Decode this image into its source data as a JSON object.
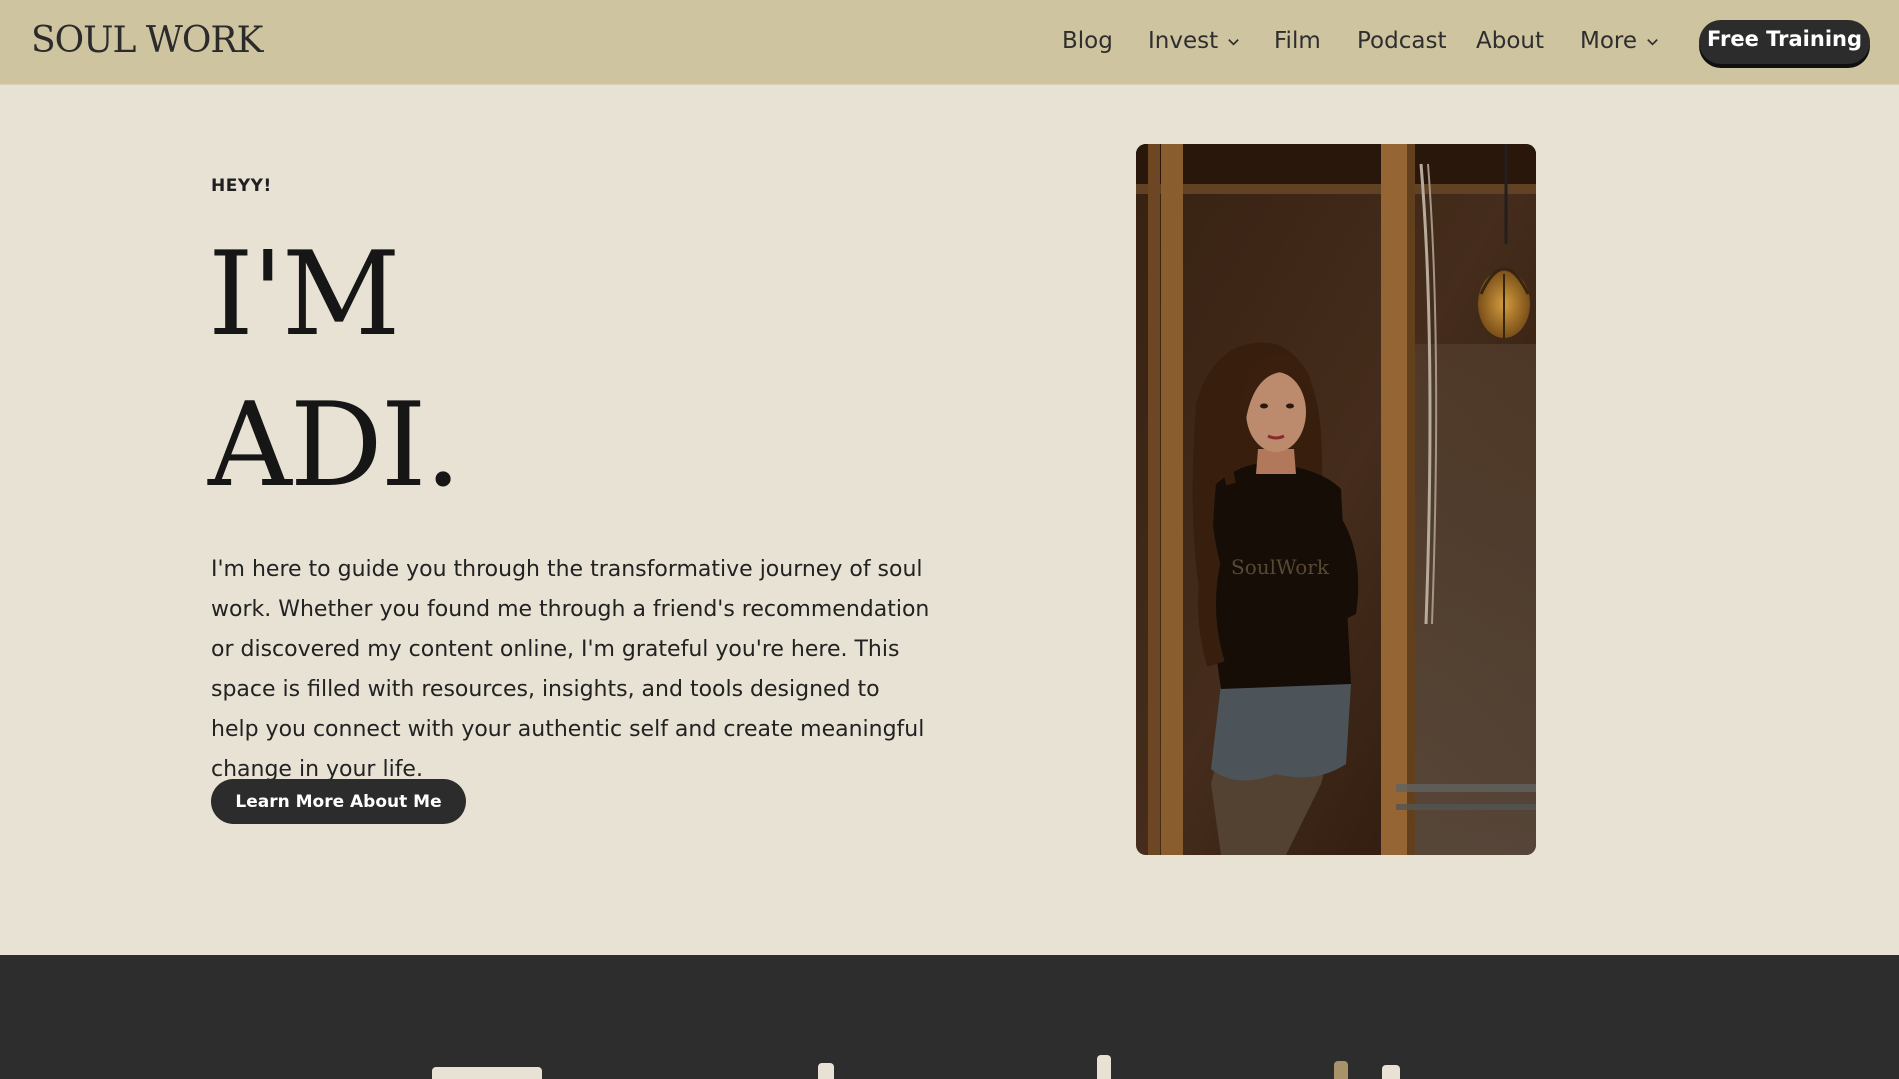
{
  "header": {
    "logo": "SOUL WORK",
    "nav": [
      {
        "label": "Blog",
        "has_dropdown": false
      },
      {
        "label": "Invest",
        "has_dropdown": true
      },
      {
        "label": "Film",
        "has_dropdown": false
      },
      {
        "label": "Podcast",
        "has_dropdown": false
      },
      {
        "label": "About",
        "has_dropdown": false
      },
      {
        "label": "More",
        "has_dropdown": true
      }
    ],
    "cta_label": "Free Training"
  },
  "hero": {
    "eyebrow": "HEYY!",
    "headline_line1": "I'M",
    "headline_line2": "ADI.",
    "body": "I'm here to guide you through the transformative journey of soul work. Whether you found me through a friend's recommendation or discovered my content online, I'm grateful you're here. This space is filled with resources, insights, and tools designed to help you connect with your authentic self and create meaningful change in your life.",
    "button_label": "Learn More About Me",
    "photo_shirt_text": "SoulWork"
  },
  "colors": {
    "header_bg": "#cfc4a0",
    "page_bg": "#e8e2d5",
    "dark_section_bg": "#2d2d2d",
    "button_bg": "#2c2c2c",
    "accent_tan": "#a8926a"
  }
}
